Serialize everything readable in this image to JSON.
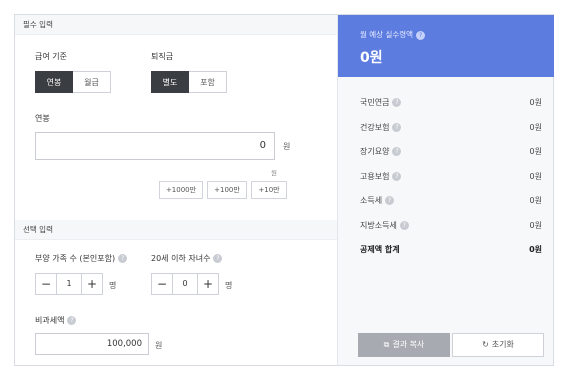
{
  "required": {
    "section_title": "필수 입력",
    "salary_basis": {
      "label": "급여 기준",
      "options": [
        "연봉",
        "월급"
      ],
      "selected": 0
    },
    "severance": {
      "label": "퇴직금",
      "options": [
        "별도",
        "포함"
      ],
      "selected": 0
    },
    "annual_salary": {
      "label": "연봉",
      "value": "0",
      "unit": "원",
      "sub_unit": "원"
    },
    "quick_buttons": [
      "+1000만",
      "+100만",
      "+10만"
    ]
  },
  "optional": {
    "section_title": "선택 입력",
    "dependents": {
      "label": "부양 가족 수 (본인포함)",
      "minus": "−",
      "value": "1",
      "plus": "+",
      "unit": "명"
    },
    "children": {
      "label": "20세 이하 자녀수",
      "minus": "−",
      "value": "0",
      "plus": "+",
      "unit": "명"
    },
    "nontaxable": {
      "label": "비과세액",
      "value": "100,000",
      "unit": "원"
    }
  },
  "result": {
    "title": "월 예상 실수령액",
    "amount": "0원",
    "rows": [
      {
        "label": "국민연금",
        "value": "0원"
      },
      {
        "label": "건강보험",
        "value": "0원"
      },
      {
        "label": "장기요양",
        "value": "0원"
      },
      {
        "label": "고용보험",
        "value": "0원"
      },
      {
        "label": "소득세",
        "value": "0원"
      },
      {
        "label": "지방소득세",
        "value": "0원"
      }
    ],
    "total": {
      "label": "공제액 합계",
      "value": "0원"
    },
    "copy_label": "결과 복사",
    "reset_label": "초기화"
  },
  "icons": {
    "help": "question-circle-icon",
    "copy": "copy-icon",
    "reset": "refresh-icon"
  },
  "colors": {
    "accent": "#5d7ce0",
    "selected_option": "#3a3d42",
    "copy_button": "#a7aab0"
  }
}
